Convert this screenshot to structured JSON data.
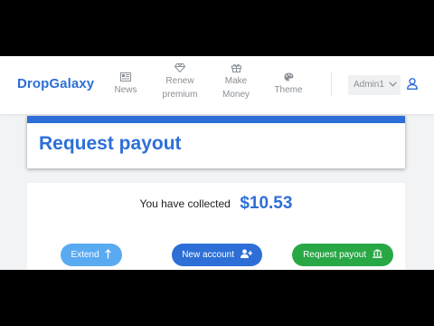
{
  "header": {
    "brand": "DropGalaxy",
    "nav": [
      {
        "label_1": "News",
        "label_2": "",
        "icon": "newspaper-icon"
      },
      {
        "label_1": "Renew",
        "label_2": "premium",
        "icon": "diamond-icon"
      },
      {
        "label_1": "Make",
        "label_2": "Money",
        "icon": "gift-icon"
      },
      {
        "label_1": "Theme",
        "label_2": "",
        "icon": "palette-icon"
      }
    ],
    "account": {
      "name": "Admin1",
      "dropdown_icon": "chevron-down-icon",
      "profile_icon": "user-icon"
    }
  },
  "page": {
    "title": "Request payout",
    "collected_label": "You have collected",
    "collected_amount": "$10.53"
  },
  "actions": {
    "extend": {
      "label": "Extend",
      "icon": "long-arrow-up-icon"
    },
    "new_account": {
      "label": "New account",
      "icon": "user-plus-icon"
    },
    "request_payout": {
      "label": "Request payout",
      "icon": "bank-icon"
    }
  },
  "colors": {
    "brand": "#2d6fd6",
    "extend_button": "#5aaaf2",
    "new_account_button": "#2d6fd6",
    "request_payout_button": "#28a745",
    "background": "#f1f3f5"
  }
}
